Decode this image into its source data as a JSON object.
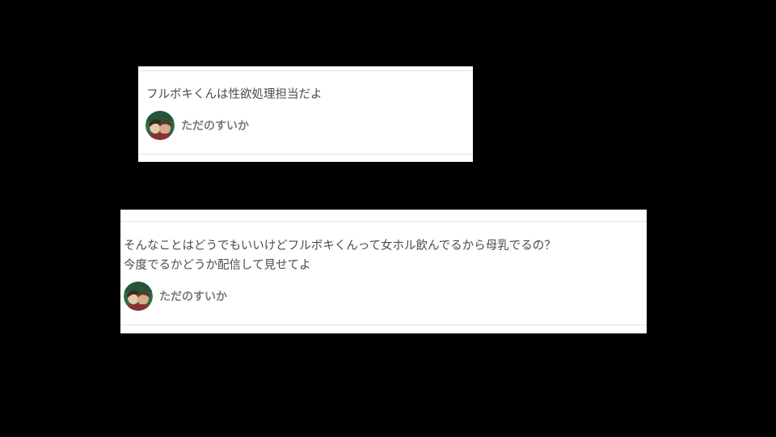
{
  "comments": [
    {
      "text": "フルボキくんは性欲処理担当だよ",
      "author": "ただのすいか"
    },
    {
      "text": "そんなことはどうでもいいけどフルボキくんって女ホル飲んでるから母乳でるの？\n今度でるかどうか配信して見せてよ",
      "author": "ただのすいか"
    }
  ],
  "icons": {
    "avatar": "user-avatar-icon"
  }
}
